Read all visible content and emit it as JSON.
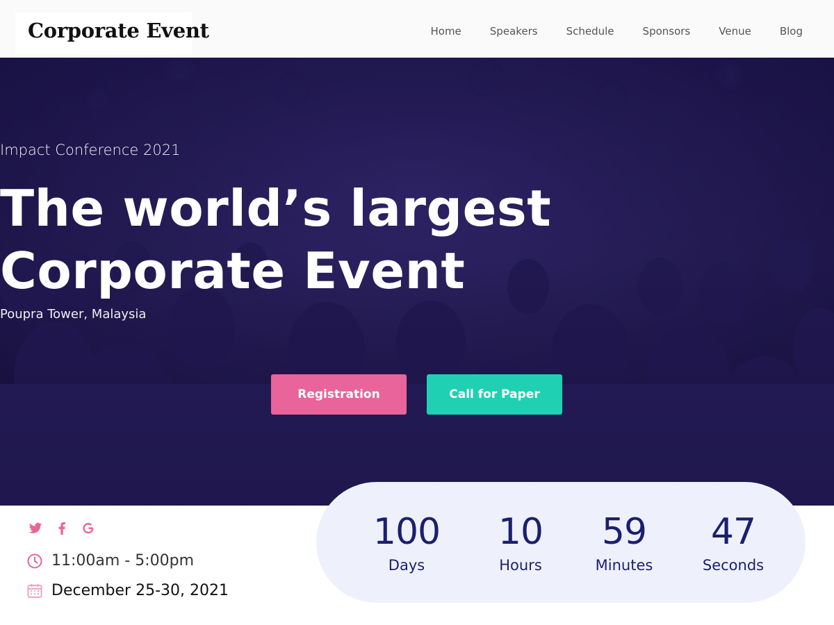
{
  "nav": {
    "logo": "Corporate Event",
    "links": [
      "Home",
      "Speakers",
      "Schedule",
      "Sponsors",
      "Venue",
      "Blog"
    ]
  },
  "hero": {
    "eyebrow": "Impact Conference 2021",
    "headline_line1": "The world’s largest",
    "headline_line2": "Corporate Event",
    "location": "Poupra Tower, Malaysia",
    "register_label": "Registration",
    "paper_label": "Call for Paper"
  },
  "social": {
    "icons": [
      "twitter-icon",
      "facebook-icon",
      "google-icon"
    ]
  },
  "info": {
    "time": "11:00am - 5:00pm",
    "date": "December 25-30, 2021"
  },
  "countdown": {
    "days": {
      "value": "100",
      "label": "Days"
    },
    "hours": {
      "value": "10",
      "label": "Hours"
    },
    "minutes": {
      "value": "59",
      "label": "Minutes"
    },
    "seconds": {
      "value": "47",
      "label": "Seconds"
    }
  },
  "colors": {
    "accent_pink": "#e8649a",
    "accent_teal": "#1fd1b2",
    "hero_bg": "#1f1848",
    "countdown_text": "#1b1f6e",
    "countdown_bg": "#eef1fb"
  }
}
